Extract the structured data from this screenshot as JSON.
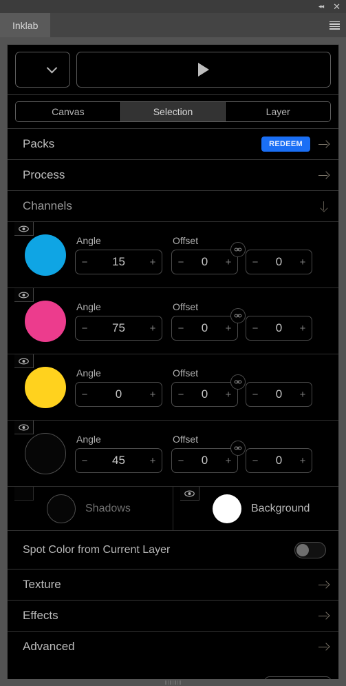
{
  "window": {
    "collapse_icon": "double-chevron-left-icon",
    "close_icon": "close-icon",
    "collapse_glyph": "◂◂",
    "close_glyph": "✕"
  },
  "app": {
    "tab_label": "Inklab",
    "menu_icon": "hamburger-menu-icon"
  },
  "toolbar": {
    "preset_dropdown_value": "",
    "preset_dropdown_icon": "chevron-down-icon",
    "run_button_label": "",
    "run_button_icon": "play-icon"
  },
  "scope_tabs": {
    "items": [
      {
        "label": "Canvas",
        "active": false
      },
      {
        "label": "Selection",
        "active": true
      },
      {
        "label": "Layer",
        "active": false
      }
    ]
  },
  "sections": {
    "packs": {
      "title": "Packs",
      "redeem_label": "REDEEM",
      "arrow_icon": "arrow-right-icon"
    },
    "process": {
      "title": "Process",
      "arrow_icon": "arrow-right-icon"
    },
    "channels": {
      "title": "Channels",
      "arrow_icon": "arrow-down-icon",
      "expanded": true
    },
    "texture": {
      "title": "Texture",
      "arrow_icon": "arrow-right-icon"
    },
    "effects": {
      "title": "Effects",
      "arrow_icon": "arrow-right-icon"
    },
    "advanced": {
      "title": "Advanced",
      "arrow_icon": "arrow-right-icon"
    }
  },
  "channels": {
    "angle_label": "Angle",
    "offset_label": "Offset",
    "minus_glyph": "−",
    "plus_glyph": "+",
    "link_icon": "link-chain-icon",
    "eye_icon": "eye-visible-icon",
    "rows": [
      {
        "name": "cyan",
        "color": "#0FA5E4",
        "visible": true,
        "angle": "15",
        "offset_x": "0",
        "offset_y": "0",
        "linked": true,
        "outlined": false
      },
      {
        "name": "magenta",
        "color": "#EC3C8D",
        "visible": true,
        "angle": "75",
        "offset_x": "0",
        "offset_y": "0",
        "linked": true,
        "outlined": false
      },
      {
        "name": "yellow",
        "color": "#FFD21E",
        "visible": true,
        "angle": "0",
        "offset_x": "0",
        "offset_y": "0",
        "linked": true,
        "outlined": false
      },
      {
        "name": "black",
        "color": "#060606",
        "visible": true,
        "angle": "45",
        "offset_x": "0",
        "offset_y": "0",
        "linked": true,
        "outlined": true
      }
    ]
  },
  "extra_channels": {
    "shadows": {
      "label": "Shadows",
      "color": "#060606",
      "visible": false,
      "outlined": true
    },
    "background": {
      "label": "Background",
      "color": "#FFFFFF",
      "visible": true,
      "outlined": false
    }
  },
  "spot_color": {
    "label": "Spot Color from Current Layer",
    "enabled": false
  },
  "colors": {
    "accent_blue": "#1A6FF5",
    "panel_bg": "#000000",
    "window_bg": "#535353",
    "tabbar_bg": "#444444",
    "active_tab_bg": "#5A5A5A",
    "segment_active_bg": "#333333"
  }
}
